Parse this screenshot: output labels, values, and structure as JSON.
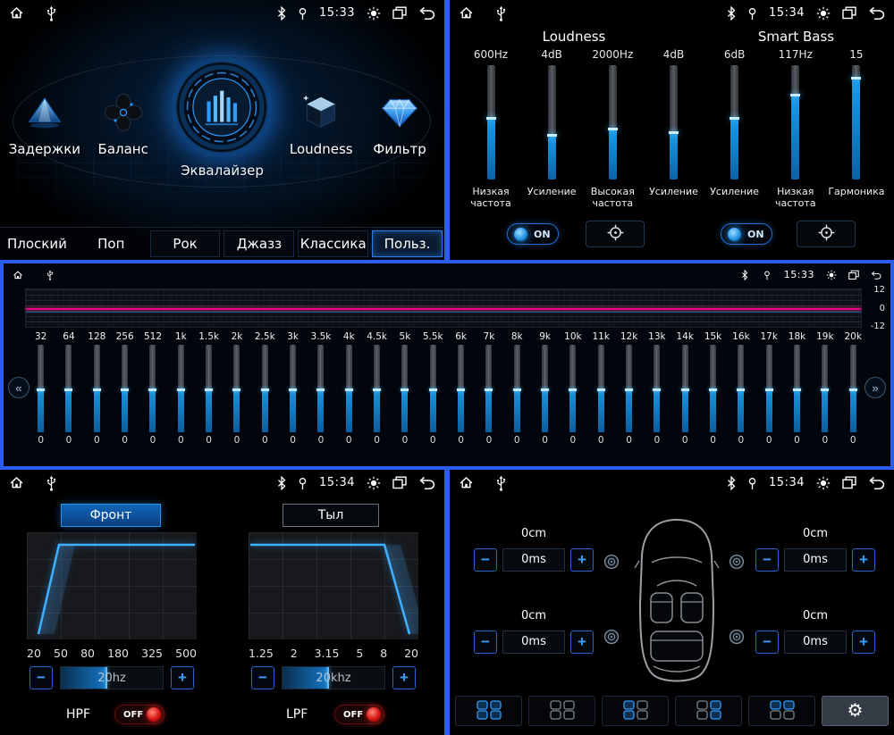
{
  "colors": {
    "divider_blue": "#2a5df0",
    "accent_blue": "#2d9cff",
    "magenta_line": "#e6007e",
    "toggle_red": "#d41414"
  },
  "status": {
    "menu": {
      "time": "15:33"
    },
    "loudness": {
      "time": "15:34"
    },
    "eq": {
      "time": "15:33"
    },
    "filter": {
      "time": "15:34"
    },
    "delay": {
      "time": "15:34"
    }
  },
  "icons": {
    "chevron_left": "«",
    "chevron_right": "»",
    "minus": "−",
    "plus": "+",
    "gear": "⚙"
  },
  "menu": {
    "items": [
      "Задержки",
      "Баланс",
      "Эквалайзер",
      "Loudness",
      "Фильтр"
    ],
    "presets": [
      {
        "label": "Плоский",
        "style": "plain"
      },
      {
        "label": "Поп",
        "style": "plain"
      },
      {
        "label": "Рок",
        "style": "boxed"
      },
      {
        "label": "Джазз",
        "style": "boxed"
      },
      {
        "label": "Классика",
        "style": "boxed"
      },
      {
        "label": "Польз.",
        "style": "active"
      }
    ]
  },
  "loudness": {
    "section_left": "Loudness",
    "section_right": "Smart Bass",
    "on_label": "ON",
    "sliders": [
      {
        "value": "600Hz",
        "label": "Низкая частота",
        "fill": 55
      },
      {
        "value": "4dB",
        "label": "Усиление",
        "fill": 40
      },
      {
        "value": "2000Hz",
        "label": "Высокая частота",
        "fill": 45
      },
      {
        "value": "4dB",
        "label": "Усиление",
        "fill": 42
      },
      {
        "value": "6dB",
        "label": "Усиление",
        "fill": 55
      },
      {
        "value": "117Hz",
        "label": "Низкая частота",
        "fill": 75
      },
      {
        "value": "15",
        "label": "Гармоника",
        "fill": 90
      }
    ]
  },
  "eq": {
    "scale": [
      "12",
      "0",
      "-12"
    ],
    "gain": "0",
    "bands": [
      "32",
      "64",
      "128",
      "256",
      "512",
      "1k",
      "1.5k",
      "2k",
      "2.5k",
      "3k",
      "3.5k",
      "4k",
      "4.5k",
      "5k",
      "5.5k",
      "6k",
      "7k",
      "8k",
      "9k",
      "10k",
      "11k",
      "12k",
      "13k",
      "14k",
      "15k",
      "16k",
      "17k",
      "18k",
      "19k",
      "20k"
    ]
  },
  "filter": {
    "tabs": [
      {
        "label": "Фронт",
        "active": true
      },
      {
        "label": "Тыл",
        "active": false
      }
    ],
    "hpf": {
      "name": "HPF",
      "value": "20hz",
      "state": "OFF",
      "scale": [
        "20",
        "50",
        "80",
        "180",
        "325",
        "500"
      ]
    },
    "lpf": {
      "name": "LPF",
      "value": "20khz",
      "state": "OFF",
      "scale": [
        "1.25",
        "2",
        "3.15",
        "5",
        "8",
        "20"
      ]
    }
  },
  "delay": {
    "corners": [
      {
        "pos": "front-left",
        "distance": "0cm",
        "time": "0ms"
      },
      {
        "pos": "front-right",
        "distance": "0cm",
        "time": "0ms"
      },
      {
        "pos": "rear-left",
        "distance": "0cm",
        "time": "0ms"
      },
      {
        "pos": "rear-right",
        "distance": "0cm",
        "time": "0ms"
      }
    ],
    "seat_buttons": [
      {
        "seats": [
          1,
          1,
          1,
          1
        ]
      },
      {
        "seats": [
          0,
          0,
          0,
          0
        ]
      },
      {
        "seats": [
          1,
          0,
          1,
          0
        ]
      },
      {
        "seats": [
          0,
          1,
          0,
          1
        ]
      },
      {
        "seats": [
          1,
          1,
          0,
          0
        ]
      }
    ]
  }
}
